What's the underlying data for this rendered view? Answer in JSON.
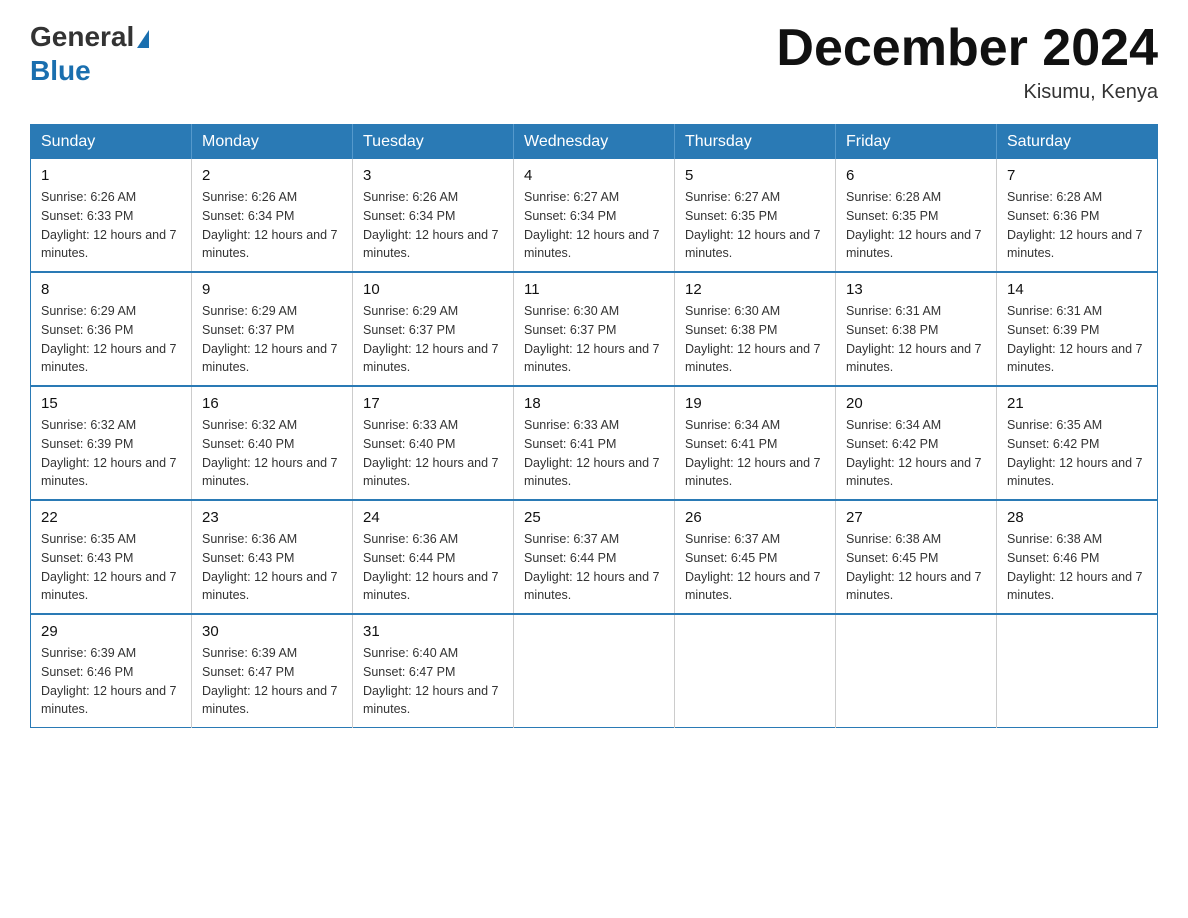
{
  "header": {
    "logo_general": "General",
    "logo_blue": "Blue",
    "month_title": "December 2024",
    "location": "Kisumu, Kenya"
  },
  "days_of_week": [
    "Sunday",
    "Monday",
    "Tuesday",
    "Wednesday",
    "Thursday",
    "Friday",
    "Saturday"
  ],
  "weeks": [
    [
      {
        "day": "1",
        "sunrise": "6:26 AM",
        "sunset": "6:33 PM",
        "daylight": "12 hours and 7 minutes."
      },
      {
        "day": "2",
        "sunrise": "6:26 AM",
        "sunset": "6:34 PM",
        "daylight": "12 hours and 7 minutes."
      },
      {
        "day": "3",
        "sunrise": "6:26 AM",
        "sunset": "6:34 PM",
        "daylight": "12 hours and 7 minutes."
      },
      {
        "day": "4",
        "sunrise": "6:27 AM",
        "sunset": "6:34 PM",
        "daylight": "12 hours and 7 minutes."
      },
      {
        "day": "5",
        "sunrise": "6:27 AM",
        "sunset": "6:35 PM",
        "daylight": "12 hours and 7 minutes."
      },
      {
        "day": "6",
        "sunrise": "6:28 AM",
        "sunset": "6:35 PM",
        "daylight": "12 hours and 7 minutes."
      },
      {
        "day": "7",
        "sunrise": "6:28 AM",
        "sunset": "6:36 PM",
        "daylight": "12 hours and 7 minutes."
      }
    ],
    [
      {
        "day": "8",
        "sunrise": "6:29 AM",
        "sunset": "6:36 PM",
        "daylight": "12 hours and 7 minutes."
      },
      {
        "day": "9",
        "sunrise": "6:29 AM",
        "sunset": "6:37 PM",
        "daylight": "12 hours and 7 minutes."
      },
      {
        "day": "10",
        "sunrise": "6:29 AM",
        "sunset": "6:37 PM",
        "daylight": "12 hours and 7 minutes."
      },
      {
        "day": "11",
        "sunrise": "6:30 AM",
        "sunset": "6:37 PM",
        "daylight": "12 hours and 7 minutes."
      },
      {
        "day": "12",
        "sunrise": "6:30 AM",
        "sunset": "6:38 PM",
        "daylight": "12 hours and 7 minutes."
      },
      {
        "day": "13",
        "sunrise": "6:31 AM",
        "sunset": "6:38 PM",
        "daylight": "12 hours and 7 minutes."
      },
      {
        "day": "14",
        "sunrise": "6:31 AM",
        "sunset": "6:39 PM",
        "daylight": "12 hours and 7 minutes."
      }
    ],
    [
      {
        "day": "15",
        "sunrise": "6:32 AM",
        "sunset": "6:39 PM",
        "daylight": "12 hours and 7 minutes."
      },
      {
        "day": "16",
        "sunrise": "6:32 AM",
        "sunset": "6:40 PM",
        "daylight": "12 hours and 7 minutes."
      },
      {
        "day": "17",
        "sunrise": "6:33 AM",
        "sunset": "6:40 PM",
        "daylight": "12 hours and 7 minutes."
      },
      {
        "day": "18",
        "sunrise": "6:33 AM",
        "sunset": "6:41 PM",
        "daylight": "12 hours and 7 minutes."
      },
      {
        "day": "19",
        "sunrise": "6:34 AM",
        "sunset": "6:41 PM",
        "daylight": "12 hours and 7 minutes."
      },
      {
        "day": "20",
        "sunrise": "6:34 AM",
        "sunset": "6:42 PM",
        "daylight": "12 hours and 7 minutes."
      },
      {
        "day": "21",
        "sunrise": "6:35 AM",
        "sunset": "6:42 PM",
        "daylight": "12 hours and 7 minutes."
      }
    ],
    [
      {
        "day": "22",
        "sunrise": "6:35 AM",
        "sunset": "6:43 PM",
        "daylight": "12 hours and 7 minutes."
      },
      {
        "day": "23",
        "sunrise": "6:36 AM",
        "sunset": "6:43 PM",
        "daylight": "12 hours and 7 minutes."
      },
      {
        "day": "24",
        "sunrise": "6:36 AM",
        "sunset": "6:44 PM",
        "daylight": "12 hours and 7 minutes."
      },
      {
        "day": "25",
        "sunrise": "6:37 AM",
        "sunset": "6:44 PM",
        "daylight": "12 hours and 7 minutes."
      },
      {
        "day": "26",
        "sunrise": "6:37 AM",
        "sunset": "6:45 PM",
        "daylight": "12 hours and 7 minutes."
      },
      {
        "day": "27",
        "sunrise": "6:38 AM",
        "sunset": "6:45 PM",
        "daylight": "12 hours and 7 minutes."
      },
      {
        "day": "28",
        "sunrise": "6:38 AM",
        "sunset": "6:46 PM",
        "daylight": "12 hours and 7 minutes."
      }
    ],
    [
      {
        "day": "29",
        "sunrise": "6:39 AM",
        "sunset": "6:46 PM",
        "daylight": "12 hours and 7 minutes."
      },
      {
        "day": "30",
        "sunrise": "6:39 AM",
        "sunset": "6:47 PM",
        "daylight": "12 hours and 7 minutes."
      },
      {
        "day": "31",
        "sunrise": "6:40 AM",
        "sunset": "6:47 PM",
        "daylight": "12 hours and 7 minutes."
      },
      null,
      null,
      null,
      null
    ]
  ]
}
